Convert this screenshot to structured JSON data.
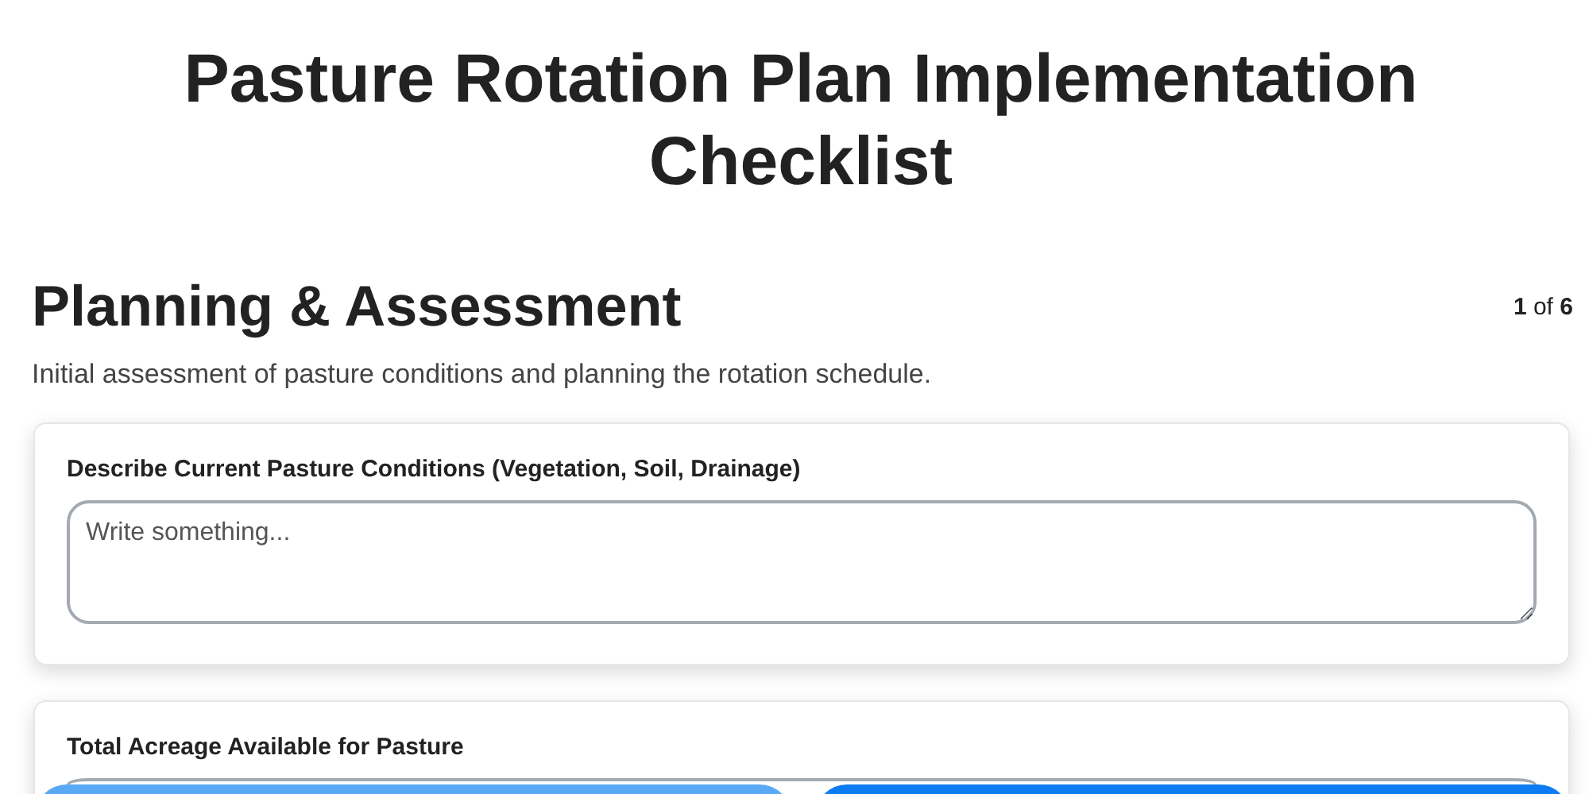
{
  "title": "Pasture Rotation Plan Implementation Checklist",
  "section": {
    "heading": "Planning & Assessment",
    "progress": "**1** of **6**",
    "description": "Initial assessment of pasture conditions and planning the rotation schedule."
  },
  "questions": [
    {
      "kind": "textarea",
      "label": "Describe Current Pasture Conditions (Vegetation, Soil, Drainage)",
      "placeholder": "Write something..."
    },
    {
      "kind": "number",
      "label": "Total Acreage Available for Pasture"
    }
  ],
  "nav_buttons": [
    {
      "disabled": true
    },
    {
      "disabled": false
    }
  ]
}
